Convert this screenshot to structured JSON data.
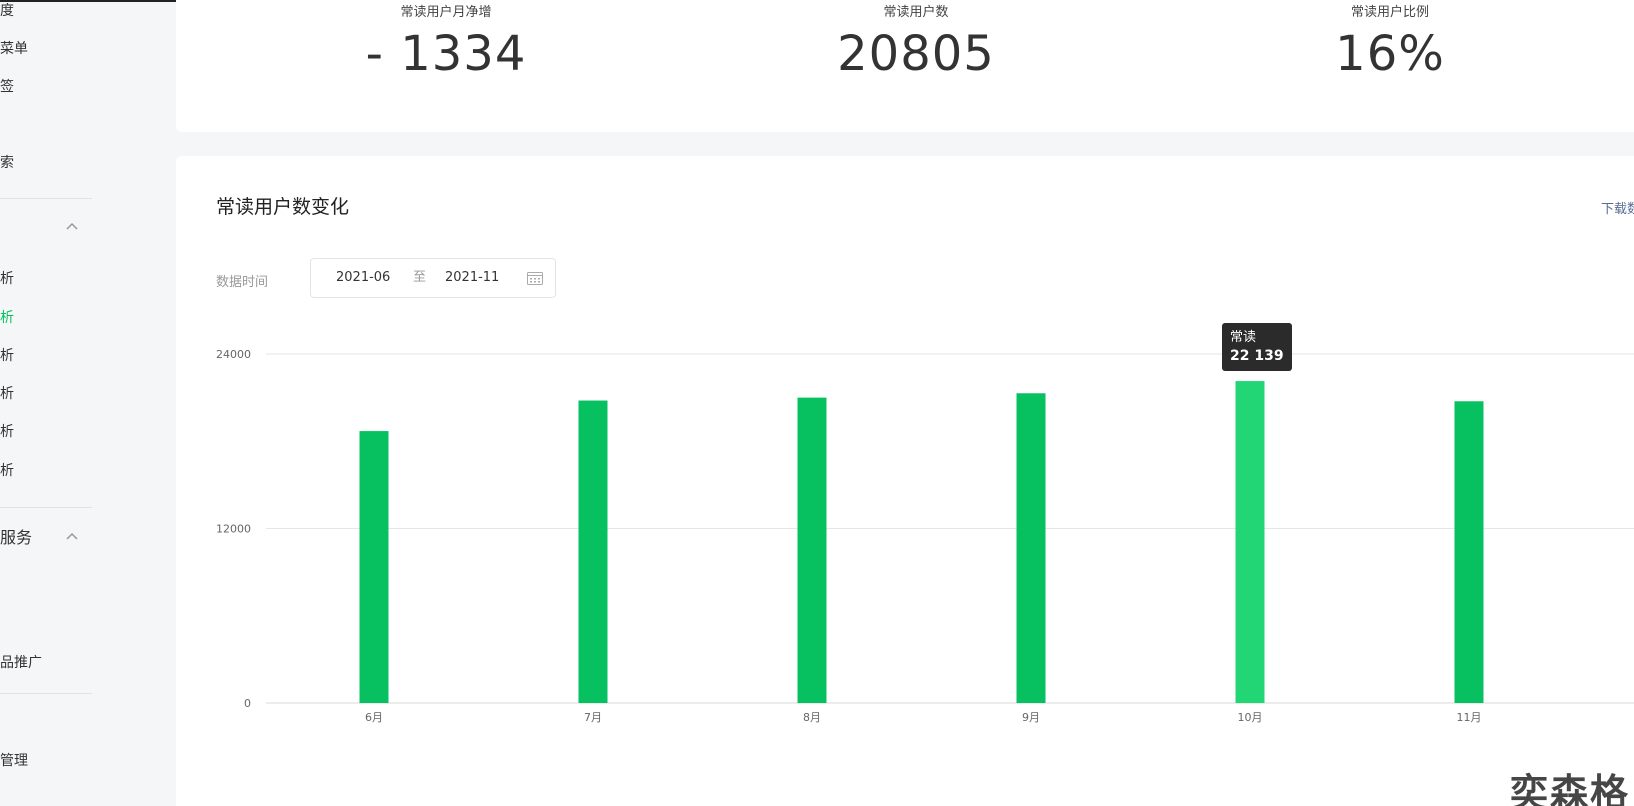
{
  "sidebar": {
    "items": [
      {
        "label": "度",
        "top": 0,
        "active": false
      },
      {
        "label": "菜单",
        "top": 0,
        "active": false
      },
      {
        "label": "签",
        "top": 0,
        "active": false
      },
      {
        "label": "索",
        "top": 0,
        "active": false
      }
    ],
    "group1": {
      "label": ""
    },
    "group1_items": [
      {
        "label": "析"
      },
      {
        "label": "析"
      },
      {
        "label": "析"
      },
      {
        "label": "析"
      },
      {
        "label": "析"
      },
      {
        "label": "析"
      }
    ],
    "group2": {
      "label": "服务"
    },
    "group2_items": [
      {
        "label": "品推广"
      }
    ],
    "bottom_item": {
      "label": "管理"
    }
  },
  "stats": [
    {
      "label": "常读用户月净增",
      "value": "- 1334"
    },
    {
      "label": "常读用户数",
      "value": "20805"
    },
    {
      "label": "常读用户比例",
      "value": "16%"
    }
  ],
  "chart_card": {
    "title": "常读用户数变化",
    "download_label": "下载数",
    "time_label": "数据时间",
    "date_start": "2021-06",
    "date_sep": "至",
    "date_end": "2021-11"
  },
  "tooltip": {
    "series_name": "常读",
    "value_text": "22 139"
  },
  "watermark": "奕森格",
  "colors": {
    "bar": "#07c160",
    "bar_highlight": "#22d676",
    "grid": "#e6e6e6",
    "axis_text": "#666666",
    "active_nav": "#07c160",
    "link": "#576b95"
  },
  "chart_data": {
    "type": "bar",
    "categories": [
      "6月",
      "7月",
      "8月",
      "9月",
      "10月",
      "11月"
    ],
    "series": [
      {
        "values": [
          18700,
          20800,
          21000,
          21300,
          22139,
          20750
        ]
      }
    ],
    "highlight_index": 4,
    "ylim": [
      0,
      24000
    ],
    "yticks": [
      0,
      12000,
      24000
    ],
    "grid": true
  }
}
